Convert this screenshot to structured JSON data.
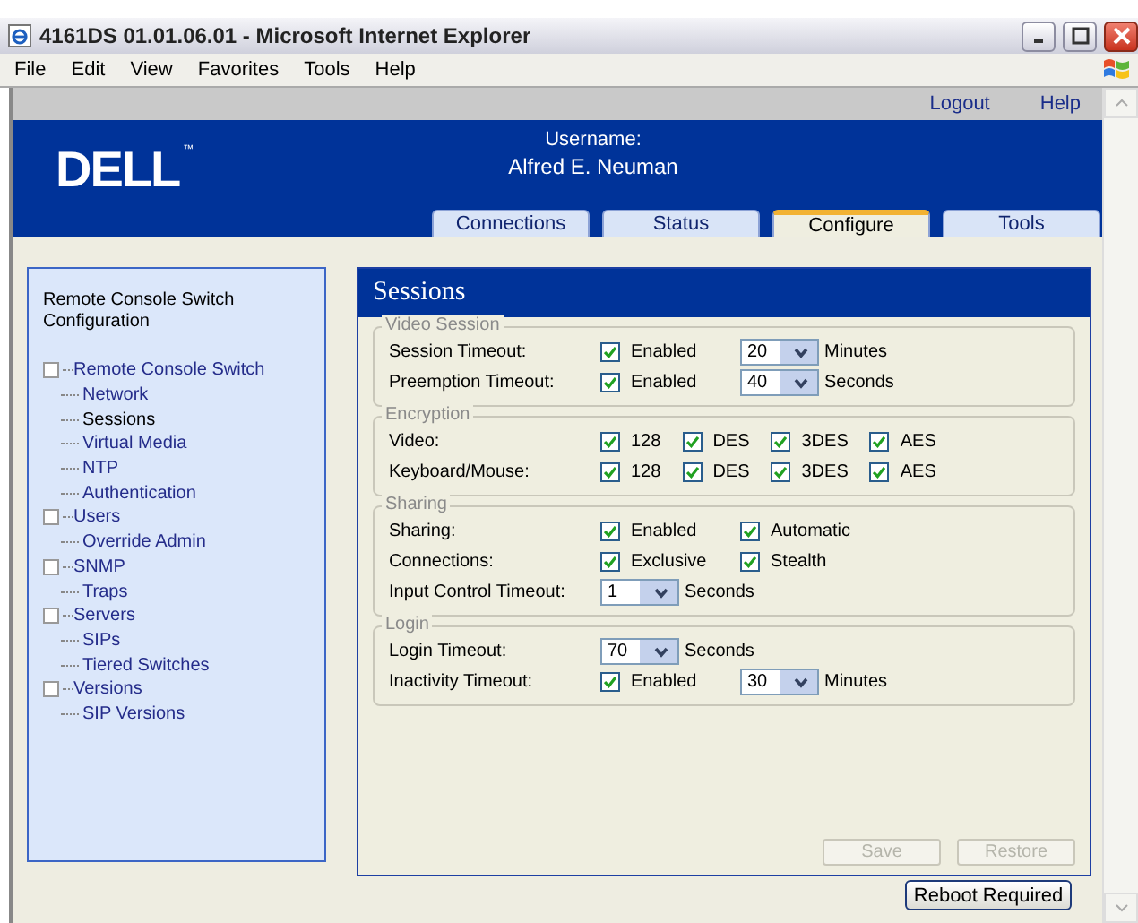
{
  "window": {
    "title": "4161DS 01.01.06.01 - Microsoft Internet Explorer",
    "menu": [
      "File",
      "Edit",
      "View",
      "Favorites",
      "Tools",
      "Help"
    ]
  },
  "top_links": [
    "Logout",
    "Help"
  ],
  "header": {
    "logo": "DELL",
    "logo_mark": "™",
    "username_label": "Username:",
    "username": "Alfred E. Neuman"
  },
  "tabs": [
    {
      "label": "Connections",
      "selected": false
    },
    {
      "label": "Status",
      "selected": false
    },
    {
      "label": "Configure",
      "selected": true
    },
    {
      "label": "Tools",
      "selected": false
    }
  ],
  "sidebar": {
    "title": "Remote Console Switch Configuration",
    "items": [
      {
        "label": "Remote Console Switch",
        "selected": false,
        "children": [
          {
            "label": "Network",
            "selected": false
          },
          {
            "label": "Sessions",
            "selected": true
          },
          {
            "label": "Virtual Media",
            "selected": false
          },
          {
            "label": "NTP",
            "selected": false
          },
          {
            "label": "Authentication",
            "selected": false
          }
        ]
      },
      {
        "label": "Users",
        "selected": false,
        "children": [
          {
            "label": "Override Admin",
            "selected": false
          }
        ]
      },
      {
        "label": "SNMP",
        "selected": false,
        "children": [
          {
            "label": "Traps",
            "selected": false
          }
        ]
      },
      {
        "label": "Servers",
        "selected": false,
        "children": [
          {
            "label": "SIPs",
            "selected": false
          },
          {
            "label": "Tiered Switches",
            "selected": false
          }
        ]
      },
      {
        "label": "Versions",
        "selected": false,
        "children": [
          {
            "label": "SIP Versions",
            "selected": false
          }
        ]
      }
    ]
  },
  "panel": {
    "title": "Sessions",
    "groups": [
      {
        "legend": "Video Session",
        "rows": [
          {
            "label": "Session Timeout:",
            "controls": [
              {
                "kind": "checkbox",
                "label": "Enabled",
                "checked": true
              },
              {
                "kind": "select",
                "value": "20"
              },
              {
                "kind": "unit",
                "text": "Minutes"
              }
            ]
          },
          {
            "label": "Preemption Timeout:",
            "controls": [
              {
                "kind": "checkbox",
                "label": "Enabled",
                "checked": true
              },
              {
                "kind": "select",
                "value": "40"
              },
              {
                "kind": "unit",
                "text": "Seconds"
              }
            ]
          }
        ]
      },
      {
        "legend": "Encryption",
        "rows": [
          {
            "label": "Video:",
            "controls": [
              {
                "kind": "checkbox",
                "label": "128",
                "checked": true
              },
              {
                "kind": "checkbox",
                "label": "DES",
                "checked": true
              },
              {
                "kind": "checkbox",
                "label": "3DES",
                "checked": true
              },
              {
                "kind": "checkbox",
                "label": "AES",
                "checked": true
              }
            ]
          },
          {
            "label": "Keyboard/Mouse:",
            "controls": [
              {
                "kind": "checkbox",
                "label": "128",
                "checked": true
              },
              {
                "kind": "checkbox",
                "label": "DES",
                "checked": true
              },
              {
                "kind": "checkbox",
                "label": "3DES",
                "checked": true
              },
              {
                "kind": "checkbox",
                "label": "AES",
                "checked": true
              }
            ]
          }
        ]
      },
      {
        "legend": "Sharing",
        "rows": [
          {
            "label": "Sharing:",
            "controls": [
              {
                "kind": "checkbox",
                "label": "Enabled",
                "checked": true
              },
              {
                "kind": "checkbox",
                "label": "Automatic",
                "checked": true
              }
            ]
          },
          {
            "label": "Connections:",
            "controls": [
              {
                "kind": "checkbox",
                "label": "Exclusive",
                "checked": true
              },
              {
                "kind": "checkbox",
                "label": "Stealth",
                "checked": true
              }
            ]
          },
          {
            "label": "Input Control Timeout:",
            "controls": [
              {
                "kind": "select",
                "value": "1"
              },
              {
                "kind": "unit",
                "text": "Seconds"
              }
            ]
          }
        ]
      },
      {
        "legend": "Login",
        "rows": [
          {
            "label": "Login Timeout:",
            "controls": [
              {
                "kind": "select",
                "value": "70"
              },
              {
                "kind": "unit",
                "text": "Seconds"
              }
            ]
          },
          {
            "label": "Inactivity Timeout:",
            "controls": [
              {
                "kind": "checkbox",
                "label": "Enabled",
                "checked": true
              },
              {
                "kind": "select",
                "value": "30"
              },
              {
                "kind": "unit",
                "text": "Minutes"
              }
            ]
          }
        ]
      }
    ],
    "buttons": [
      {
        "label": "Save",
        "disabled": true
      },
      {
        "label": "Restore",
        "disabled": true
      }
    ]
  },
  "footer_button": {
    "label": "Reboot Required"
  }
}
